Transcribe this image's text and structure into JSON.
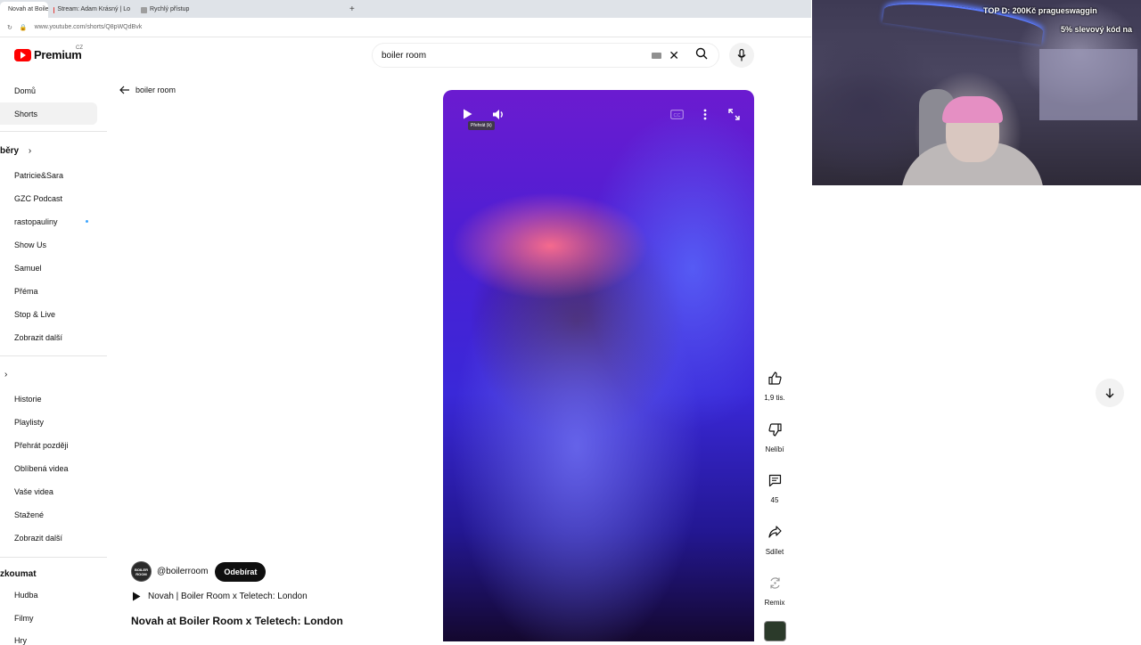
{
  "browser": {
    "tabs": [
      {
        "label": "Novah at Boiler R",
        "color": "#ff0000",
        "active": true
      },
      {
        "label": "Stream: Adam Krásný | Lo",
        "color": "#e53935",
        "active": false
      },
      {
        "label": "Rychlý přístup",
        "color": "#9e9e9e",
        "active": false
      }
    ],
    "new_tab": "+",
    "url": "www.youtube.com/shorts/Q8pWQdBvk"
  },
  "header": {
    "logo_text": "Premium",
    "region": "CZ",
    "search_value": "boiler room"
  },
  "sidebar": {
    "top": [
      {
        "label": "Domů"
      },
      {
        "label": "Shorts"
      }
    ],
    "subscriptions_heading": "běry",
    "subscriptions": [
      {
        "label": "Patricie&Sara"
      },
      {
        "label": "GZC Podcast"
      },
      {
        "label": "rastopauliny"
      },
      {
        "label": "Show Us"
      },
      {
        "label": "Samuel"
      },
      {
        "label": "Přéma"
      },
      {
        "label": "Stop & Live"
      },
      {
        "label": "Zobrazit další"
      }
    ],
    "you_items": [
      {
        "label": "Historie"
      },
      {
        "label": "Playlisty"
      },
      {
        "label": "Přehrát později"
      },
      {
        "label": "Oblíbená videa"
      },
      {
        "label": "Vaše videa"
      },
      {
        "label": "Stažené"
      },
      {
        "label": "Zobrazit další"
      }
    ],
    "explore_heading": "zkoumat",
    "explore": [
      {
        "label": "Hudba"
      },
      {
        "label": "Filmy"
      },
      {
        "label": "Hry"
      }
    ]
  },
  "main": {
    "back_query": "boiler room",
    "channel_handle": "@boilerroom",
    "avatar_text": "BOILER ROOM",
    "subscribe_label": "Odebírat",
    "sound": "Novah | Boiler Room x Teletech: London",
    "title": "Novah at Boiler Room x Teletech: London",
    "player_tooltip": "Přehrát (k)"
  },
  "actions": {
    "like_count": "1,9 tis.",
    "dislike_label": "Nelíbí",
    "comment_count": "45",
    "share_label": "Sdílet",
    "remix_label": "Remix"
  },
  "overlay": {
    "top_donation": "TOP D: 200Kč pragueswaggin",
    "promo": "5% slevový kód na"
  },
  "colors": {
    "brand_red": "#ff0000",
    "subscribe_bg": "#0f0f0f",
    "active_bg": "#f2f2f2"
  }
}
